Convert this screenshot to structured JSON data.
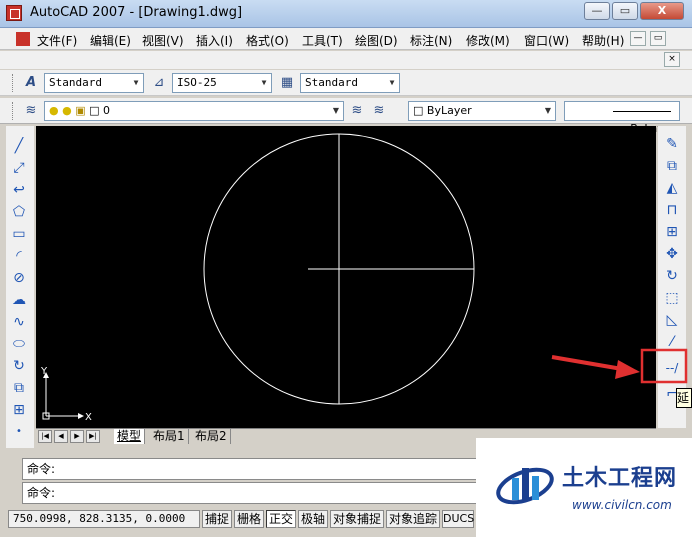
{
  "window": {
    "title": "AutoCAD 2007 - [Drawing1.dwg]",
    "minimize": "—",
    "restore": "▭",
    "close": "X"
  },
  "menu": {
    "items": [
      "文件(F)",
      "编辑(E)",
      "视图(V)",
      "插入(I)",
      "格式(O)",
      "工具(T)",
      "绘图(D)",
      "标注(N)",
      "修改(M)",
      "窗口(W)",
      "帮助(H)"
    ],
    "doc_minimize": "—",
    "doc_restore": "▭",
    "doc_close": "×"
  },
  "styles_toolbar": {
    "text_style": "Standard",
    "dim_style": "ISO-25",
    "table_style": "Standard"
  },
  "layers_toolbar": {
    "current_layer": "0",
    "color": "ByLayer",
    "linetype": "ByLayer"
  },
  "layout_tabs": [
    "模型",
    "布局1",
    "布局2"
  ],
  "ucs": {
    "y_label": "Y",
    "x_label": "X"
  },
  "command": {
    "prompt1": "命令:",
    "prompt2": "命令:"
  },
  "status": {
    "coordinates": "750.0998,  828.3135, 0.0000",
    "buttons": [
      "捕捉",
      "栅格",
      "正交",
      "极轴",
      "对象捕捉",
      "对象追踪",
      "DUCS"
    ]
  },
  "tooltip": "延",
  "watermark": {
    "name": "土木工程网",
    "url": "www.civilcn.com"
  },
  "colors": {
    "canvas_bg": "#000000",
    "highlight_box": "#e03030",
    "arrow": "#e03030",
    "titlebar": "#b8cfee"
  }
}
